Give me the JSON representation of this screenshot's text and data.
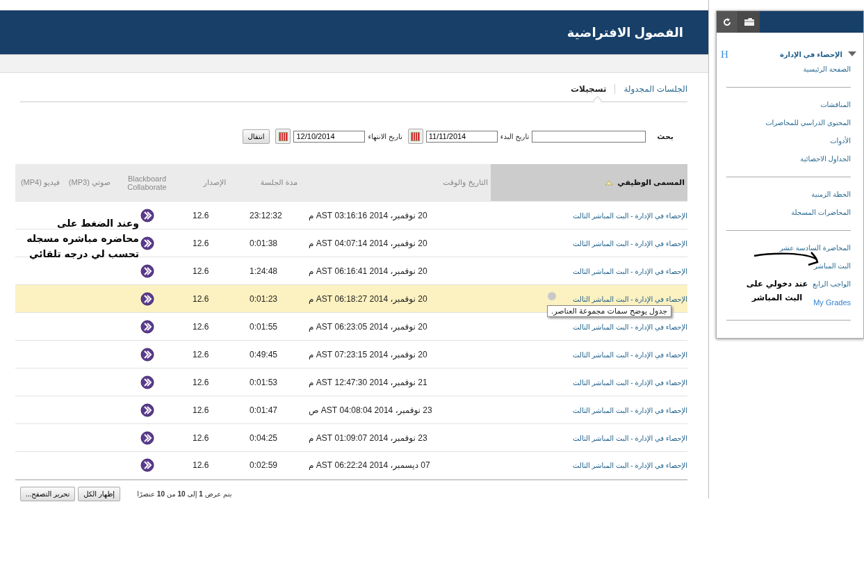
{
  "header": {
    "title": "الفصول الافتراضية"
  },
  "tabs": [
    {
      "label": "الجلسات المجدولة",
      "selected": false
    },
    {
      "label": "تسجيلات",
      "selected": true
    }
  ],
  "search": {
    "label": "بحث",
    "start_label": "تاريخ البدء",
    "start_value": "11/11/2014",
    "end_label": "تاريخ الانتهاء",
    "end_value": "12/10/2014",
    "go_button": "انتقال"
  },
  "table": {
    "columns": [
      {
        "label": "المسمى الوظيفي",
        "sorted": true
      },
      {
        "label": "التاريخ والوقت",
        "sorted": false
      },
      {
        "label": "مدة الجلسة",
        "sorted": false
      },
      {
        "label": "الإصدار",
        "sorted": false
      },
      {
        "label": "Blackboard Collaborate",
        "sorted": false
      },
      {
        "label": "صوتي (MP3)",
        "sorted": false
      },
      {
        "label": "فيديو (MP4)",
        "sorted": false
      }
    ],
    "rows": [
      {
        "title": "الإحصاء في الإدارة - البث المباشر الثالث",
        "date": "20 نوفمبر، 2014 03:16:16 AST م",
        "duration": "23:12:32",
        "version": "12.6",
        "highlighted": false
      },
      {
        "title": "الإحصاء في الإدارة - البث المباشر الثالث",
        "date": "20 نوفمبر، 2014 04:07:14 AST م",
        "duration": "0:01:38",
        "version": "12.6",
        "highlighted": false
      },
      {
        "title": "الإحصاء في الإدارة - البث المباشر الثالث",
        "date": "20 نوفمبر، 2014 06:16:41 AST م",
        "duration": "1:24:48",
        "version": "12.6",
        "highlighted": false
      },
      {
        "title": "الإحصاء في الإدارة - البث المباشر الثالث",
        "date": "20 نوفمبر، 2014 06:18:27 AST م",
        "duration": "0:01:23",
        "version": "12.6",
        "highlighted": true,
        "tooltip": "جدول يوضح سمات مجموعة العناصر."
      },
      {
        "title": "الإحصاء في الإدارة - البث المباشر الثالث",
        "date": "20 نوفمبر، 2014 06:23:05 AST م",
        "duration": "0:01:55",
        "version": "12.6",
        "highlighted": false
      },
      {
        "title": "الإحصاء في الإدارة - البث المباشر الثالث",
        "date": "20 نوفمبر، 2014 07:23:15 AST م",
        "duration": "0:49:45",
        "version": "12.6",
        "highlighted": false
      },
      {
        "title": "الإحصاء في الإدارة - البث المباشر الثالث",
        "date": "21 نوفمبر، 2014 12:47:30 AST م",
        "duration": "0:01:53",
        "version": "12.6",
        "highlighted": false
      },
      {
        "title": "الإحصاء في الإدارة - البث المباشر الثالث",
        "date": "23 نوفمبر، 2014 04:08:04 AST ص",
        "duration": "0:01:47",
        "version": "12.6",
        "highlighted": false
      },
      {
        "title": "الإحصاء في الإدارة - البث المباشر الثالث",
        "date": "23 نوفمبر، 2014 01:09:07 AST م",
        "duration": "0:04:25",
        "version": "12.6",
        "highlighted": false
      },
      {
        "title": "الإحصاء في الإدارة - البث المباشر الثالث",
        "date": "07 ديسمبر، 2014 06:22:24 AST م",
        "duration": "0:02:59",
        "version": "12.6",
        "highlighted": false
      }
    ]
  },
  "footer": {
    "summary": "يتم عرض **1** إلى **10** من **10** عنصرًا",
    "buttons": [
      "إظهار الكل",
      "تحرير التصفح..."
    ]
  },
  "sidebar": {
    "course": {
      "title": "الإحصاء في الإدارة",
      "expanded": true,
      "badge": "H"
    },
    "groups": [
      {
        "items": [
          {
            "label": "الصفحة الرئيسية",
            "kind": "normal"
          }
        ]
      },
      {
        "items": [
          {
            "label": "المناقشات",
            "kind": "normal"
          },
          {
            "label": "المحتوى الدراسي للمحاضرات",
            "kind": "normal"
          },
          {
            "label": "الأدوات",
            "kind": "normal"
          },
          {
            "label": "الجداول الاحصائية",
            "kind": "normal"
          }
        ]
      },
      {
        "items": [
          {
            "label": "الخطة الزمنية",
            "kind": "normal"
          },
          {
            "label": "المحاضرات المسجلة",
            "kind": "normal"
          }
        ]
      },
      {
        "items": [
          {
            "label": "المحاضرة السادسة عشر",
            "kind": "normal"
          },
          {
            "label": "البث المباشر",
            "kind": "normal"
          },
          {
            "label": "الواجب الرابع",
            "kind": "normal"
          },
          {
            "label": "My Grades",
            "kind": "large"
          }
        ]
      }
    ]
  },
  "annotations": [
    {
      "text": "وعند الضغط على محاضره مباشره مسجله تحسب لي درجه تلقائي",
      "kind": "table"
    },
    {
      "text": "عند دخولي على البث المباشر",
      "kind": "sidebar"
    }
  ]
}
